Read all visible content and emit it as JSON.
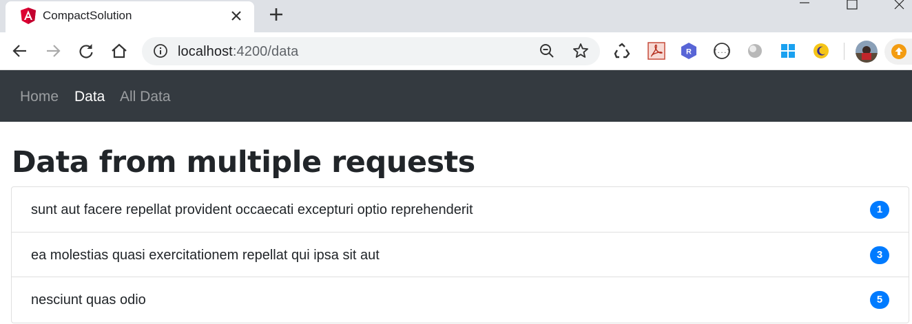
{
  "browser": {
    "tab_title": "CompactSolution",
    "url_host": "localhost",
    "url_rest": ":4200/data",
    "colors": {
      "tabstrip": "#dee1e6",
      "angular_red": "#dd0031"
    }
  },
  "navbar": {
    "items": [
      {
        "label": "Home",
        "active": false
      },
      {
        "label": "Data",
        "active": true
      },
      {
        "label": "All Data",
        "active": false
      }
    ],
    "background": "#343a40"
  },
  "main": {
    "title": "Data from multiple requests",
    "items": [
      {
        "text": "sunt aut facere repellat provident occaecati excepturi optio reprehenderit",
        "badge": "1"
      },
      {
        "text": "ea molestias quasi exercitationem repellat qui ipsa sit aut",
        "badge": "3"
      },
      {
        "text": "nesciunt quas odio",
        "badge": "5"
      }
    ],
    "badge_color": "#007bff"
  }
}
